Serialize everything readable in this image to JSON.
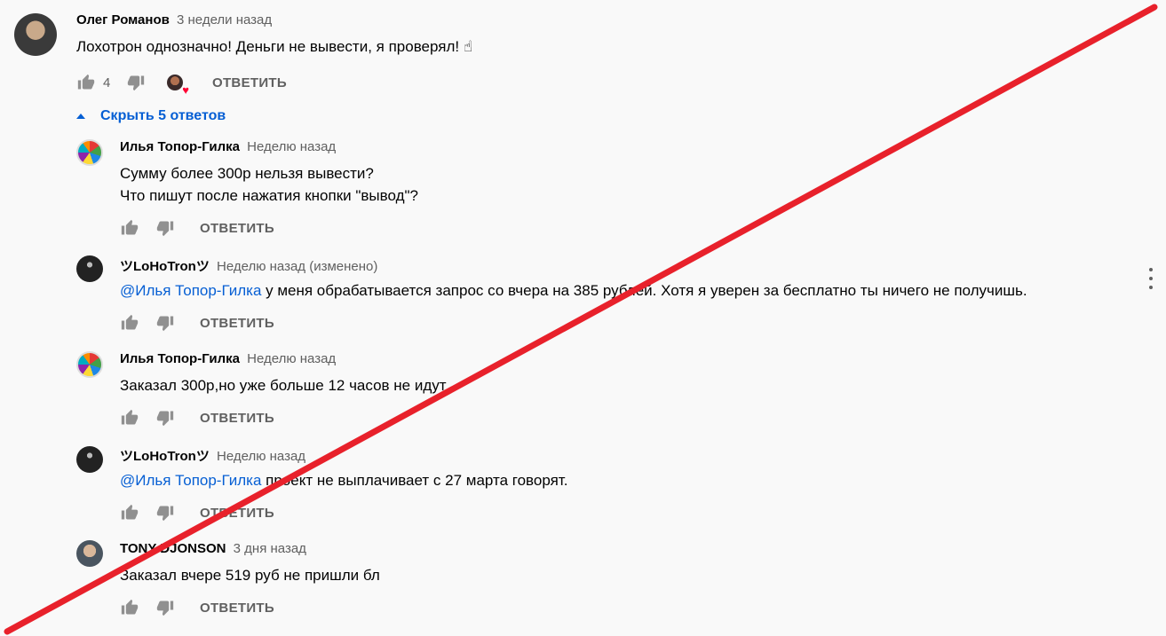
{
  "thread": {
    "top_comment": {
      "author": "Олег Романов",
      "time": "3 недели назад",
      "text": "Лохотрон однозначно! Деньги не вывести, я проверял! ☝",
      "likes": "4",
      "reply_label": "ОТВЕТИТЬ"
    },
    "replies_toggle_label": "Скрыть 5 ответов",
    "replies": [
      {
        "author": "Илья Топор-Гилка",
        "time": "Неделю назад",
        "line1": "Сумму более 300р нельзя вывести?",
        "line2": "Что пишут после нажатия кнопки \"вывод\"?",
        "reply_label": "ОТВЕТИТЬ"
      },
      {
        "author": "ツLoHoTronツ",
        "time": "Неделю назад (изменено)",
        "mention": "@Илья Топор-Гилка",
        "text": " у меня обрабатывается запрос со вчера на 385 рублей. Хотя я уверен за бесплатно ты ничего не получишь.",
        "reply_label": "ОТВЕТИТЬ"
      },
      {
        "author": "Илья Топор-Гилка",
        "time": "Неделю назад",
        "text": "Заказал 300р,но уже больше 12 часов не идут",
        "reply_label": "ОТВЕТИТЬ"
      },
      {
        "author": "ツLoHoTronツ",
        "time": "Неделю назад",
        "mention": "@Илья Топор-Гилка",
        "text": " проект не выплачивает с 27 марта говорят.",
        "reply_label": "ОТВЕТИТЬ"
      },
      {
        "author": "TONY DJONSON",
        "time": "3 дня назад",
        "text": "Заказал вчере 519 руб не пришли бл",
        "reply_label": "ОТВЕТИТЬ"
      }
    ]
  },
  "icons": {
    "like": "thumb-up-icon",
    "dislike": "thumb-down-icon",
    "creator_heart": "creator-heart-icon",
    "menu": "more-vert-icon",
    "collapse": "caret-up-icon"
  },
  "colors": {
    "link": "#065fd4",
    "strike_line": "#e8212b",
    "background": "#f9f9f9"
  }
}
